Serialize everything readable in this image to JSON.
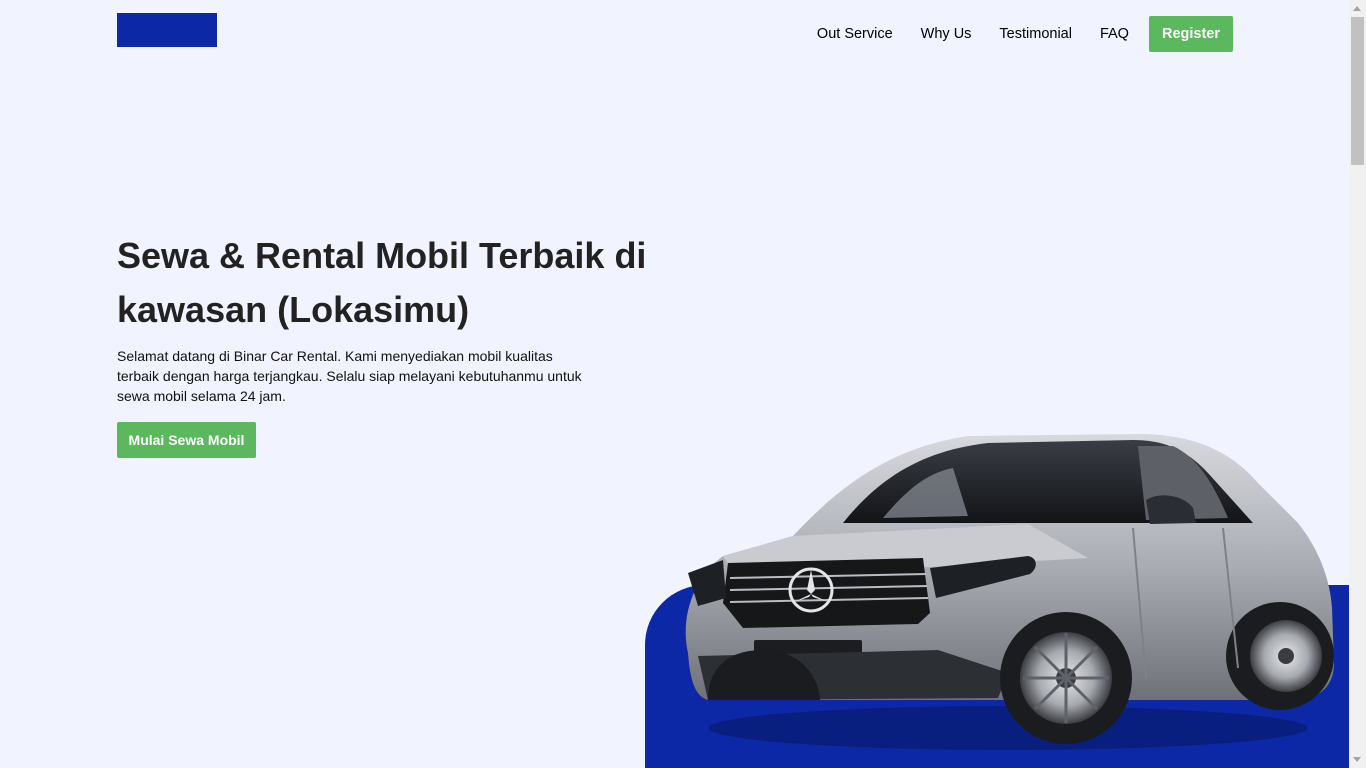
{
  "nav": {
    "items": [
      "Out Service",
      "Why Us",
      "Testimonial",
      "FAQ"
    ],
    "register_label": "Register"
  },
  "hero": {
    "title": "Sewa & Rental Mobil Terbaik di kawasan (Lokasimu)",
    "description": "Selamat datang di Binar Car Rental. Kami menyediakan mobil kualitas terbaik dengan harga terjangkau. Selalu siap melayani kebutuhanmu untuk sewa mobil selama 24 jam.",
    "cta_label": "Mulai Sewa Mobil"
  },
  "colors": {
    "brand_blue": "#0D28A6",
    "accent_green": "#5CB85F",
    "background": "#F1F3FF"
  },
  "icons": {
    "car": "car-image",
    "logo": "logo-block"
  }
}
